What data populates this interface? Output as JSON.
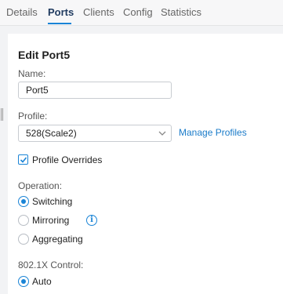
{
  "tabs": [
    {
      "label": "Details"
    },
    {
      "label": "Ports",
      "active": true
    },
    {
      "label": "Clients"
    },
    {
      "label": "Config"
    },
    {
      "label": "Statistics"
    }
  ],
  "form": {
    "title": "Edit Port5",
    "name_label": "Name:",
    "name_value": "Port5",
    "profile_label": "Profile:",
    "profile_value": "528(Scale2)",
    "manage_profiles": "Manage Profiles",
    "overrides_label": "Profile Overrides",
    "overrides_checked": true,
    "operation_label": "Operation:",
    "operation_options": [
      "Switching",
      "Mirroring",
      "Aggregating"
    ],
    "operation_selected": "Switching",
    "dot1x_label": "802.1X Control:",
    "dot1x_options": [
      "Auto"
    ],
    "dot1x_selected": "Auto"
  },
  "icons": {
    "info": "info-icon",
    "chevron": "chevron-down-icon",
    "check": "check-icon"
  },
  "colors": {
    "accent": "#1a84d6",
    "link": "#1a7bc9",
    "active_tab": "#1f3a5f"
  }
}
